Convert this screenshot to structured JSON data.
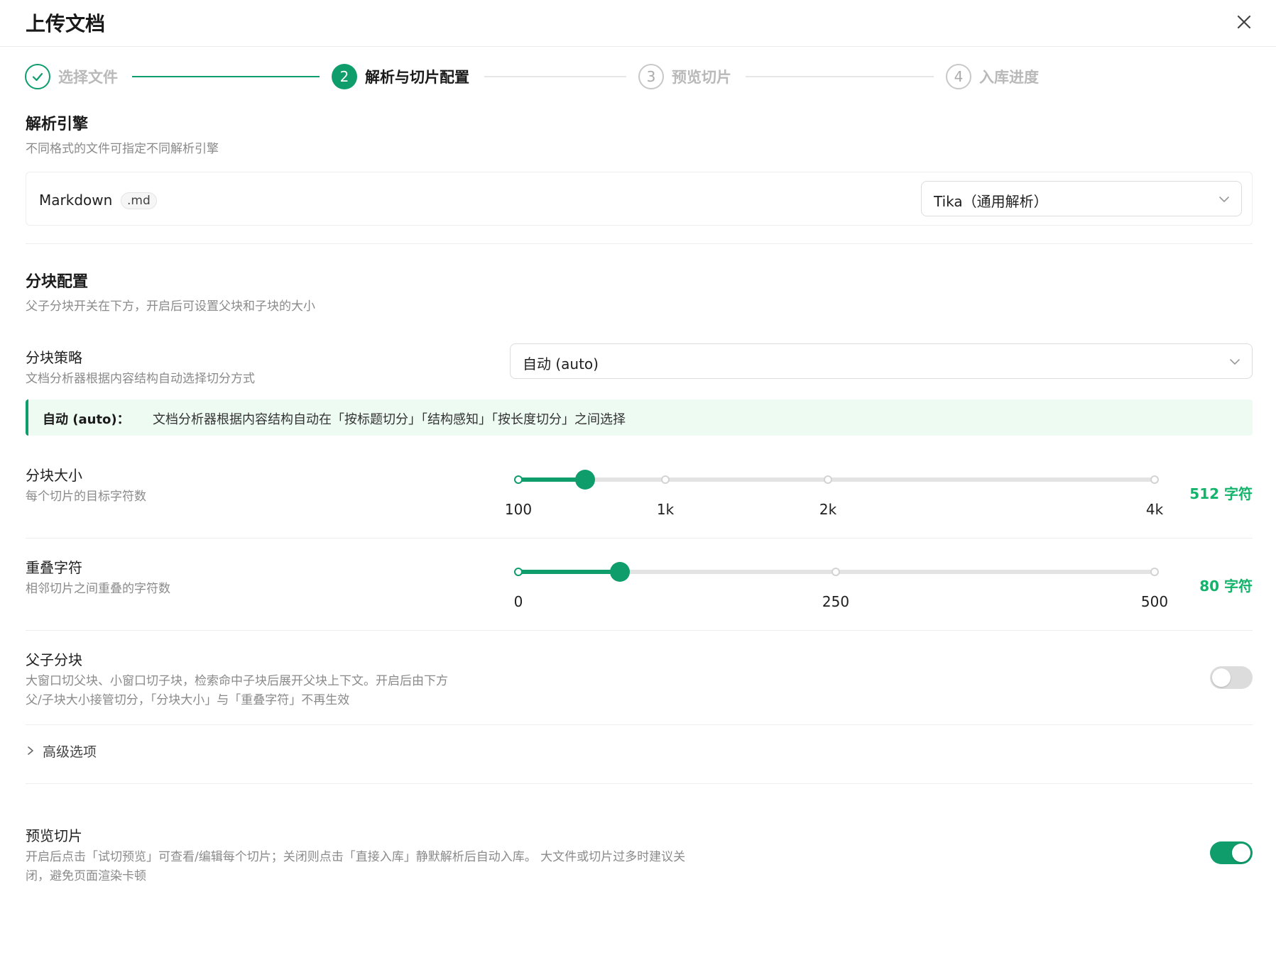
{
  "dialog": {
    "title": "上传文档"
  },
  "steps": [
    {
      "num": "1",
      "label": "选择文件",
      "status": "done"
    },
    {
      "num": "2",
      "label": "解析与切片配置",
      "status": "active"
    },
    {
      "num": "3",
      "label": "预览切片",
      "status": "wait"
    },
    {
      "num": "4",
      "label": "入库进度",
      "status": "wait"
    }
  ],
  "parser": {
    "title": "解析引擎",
    "desc": "不同格式的文件可指定不同解析引擎",
    "file_type": "Markdown",
    "extension": ".md",
    "engine": "Tika（通用解析）"
  },
  "chunk": {
    "title": "分块配置",
    "desc": "父子分块开关在下方，开启后可设置父块和子块的大小",
    "strategy": {
      "label": "分块策略",
      "desc": "文档分析器根据内容结构自动选择切分方式",
      "value": "自动 (auto)"
    },
    "note": {
      "strong": "自动 (auto)：",
      "text": "文档分析器根据内容结构自动在「按标题切分」「结构感知」「按长度切分」之间选择"
    },
    "size": {
      "label": "分块大小",
      "desc": "每个切片的目标字符数",
      "ticks": [
        "100",
        "1k",
        "2k",
        "4k"
      ],
      "value_text": "512 字符",
      "fraction": 0.105
    },
    "overlap": {
      "label": "重叠字符",
      "desc": "相邻切片之间重叠的字符数",
      "ticks": [
        "0",
        "250",
        "500"
      ],
      "value_text": "80 字符",
      "fraction": 0.16
    },
    "parent_child": {
      "label": "父子分块",
      "desc_line1": "大窗口切父块、小窗口切子块，检索命中子块后展开父块上下文。开启后由下方",
      "desc_line2": "父/子块大小接管切分，「分块大小」与「重叠字符」不再生效",
      "enabled": false
    },
    "advanced": {
      "label": "高级选项"
    }
  },
  "preview": {
    "label": "预览切片",
    "desc_line1": "开启后点击「试切预览」可查看/编辑每个切片；关闭则点击「直接入库」静默解析后自动入库。 大文件或切片过多时建议关",
    "desc_line2": "闭，避免页面渲染卡顿",
    "enabled": true
  },
  "colors": {
    "accent": "#0f9d6b",
    "value": "#13b36b"
  }
}
